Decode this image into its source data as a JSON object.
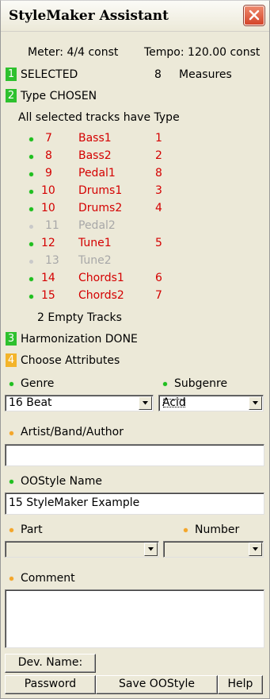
{
  "window": {
    "title": "StyleMaker Assistant"
  },
  "info": {
    "meter": "Meter:  4/4 const",
    "tempo": "Tempo: 120.00 const"
  },
  "steps": [
    {
      "num": "1",
      "label": "SELECTED",
      "color": "#2ec12e"
    },
    {
      "num": "2",
      "label": "Type CHOSEN",
      "color": "#2ec12e"
    },
    {
      "num": "3",
      "label": "Harmonization DONE",
      "color": "#2ec12e"
    },
    {
      "num": "4",
      "label": "Choose Attributes",
      "color": "#f3b42a"
    }
  ],
  "selected": {
    "count": "8",
    "unit": "Measures"
  },
  "type_note": "All selected tracks have Type",
  "tracks": [
    {
      "num": "7",
      "name": "Bass1",
      "type": "1",
      "state": "active"
    },
    {
      "num": "8",
      "name": "Bass2",
      "type": "2",
      "state": "active"
    },
    {
      "num": "9",
      "name": "Pedal1",
      "type": "8",
      "state": "active"
    },
    {
      "num": "10",
      "name": "Drums1",
      "type": "3",
      "state": "active"
    },
    {
      "num": "10",
      "name": "Drums2",
      "type": "4",
      "state": "active"
    },
    {
      "num": "11",
      "name": "Pedal2",
      "type": "",
      "state": "inactive"
    },
    {
      "num": "12",
      "name": "Tune1",
      "type": "5",
      "state": "active"
    },
    {
      "num": "13",
      "name": "Tune2",
      "type": "",
      "state": "inactive"
    },
    {
      "num": "14",
      "name": "Chords1",
      "type": "6",
      "state": "active"
    },
    {
      "num": "15",
      "name": "Chords2",
      "type": "7",
      "state": "active"
    }
  ],
  "empty_tracks": "2 Empty Tracks",
  "genre": {
    "label": "Genre",
    "value": "16 Beat"
  },
  "subgenre": {
    "label": "Subgenre",
    "value": "Acid"
  },
  "artist": {
    "label": "Artist/Band/Author",
    "value": ""
  },
  "style_name": {
    "label": "OOStyle Name",
    "value": "15 StyleMaker Example"
  },
  "part": {
    "label": "Part",
    "value": ""
  },
  "number": {
    "label": "Number",
    "value": ""
  },
  "comment": {
    "label": "Comment",
    "value": ""
  },
  "buttons": {
    "dev_name": "Dev. Name:",
    "password": "Password",
    "save": "Save OOStyle",
    "help": "Help"
  },
  "colors": {
    "required_dot": "#1fbf1f",
    "optional_dot": "#f4a62a",
    "inactive_dot": "#c9c9c9",
    "track_text": "#d40000",
    "inactive_text": "#a8a8a8"
  }
}
